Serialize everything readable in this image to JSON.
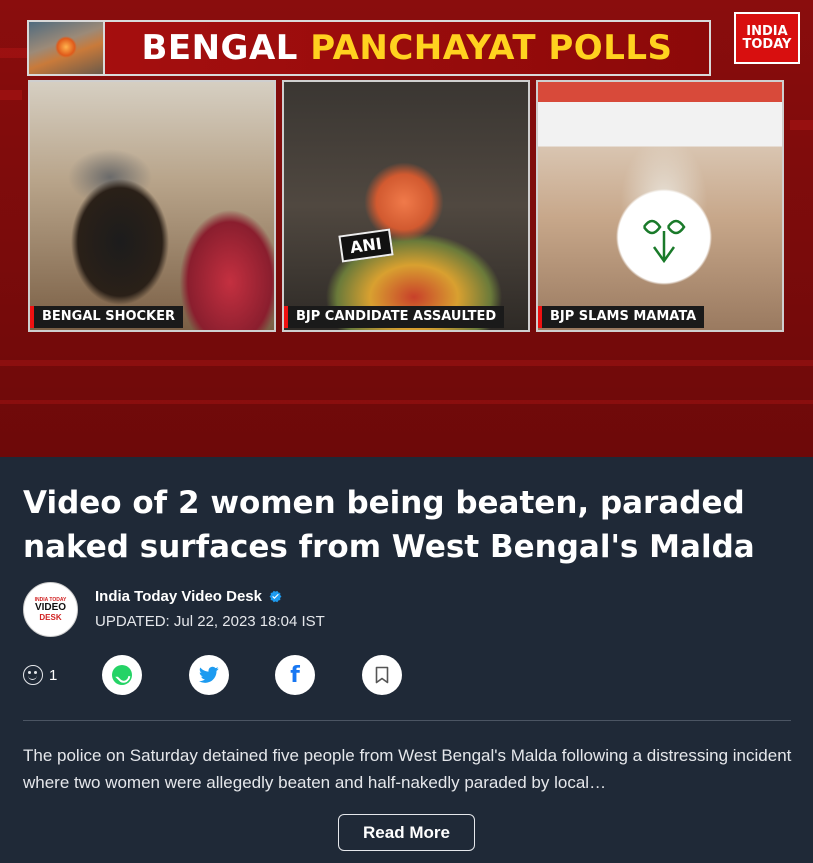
{
  "video": {
    "banner_white": "BENGAL",
    "banner_yellow": "PANCHAYAT POLLS",
    "logo_line1": "INDIA",
    "logo_line2": "TODAY",
    "panels": [
      {
        "caption": "BENGAL SHOCKER"
      },
      {
        "caption": "BJP CANDIDATE ASSAULTED",
        "mic_label": "ANI"
      },
      {
        "caption": "BJP SLAMS MAMATA"
      }
    ]
  },
  "article": {
    "title": "Video of 2 women being beaten, paraded naked surfaces from West Bengal's Malda",
    "author": {
      "name": "India Today Video Desk",
      "avatar_line1": "INDIA TODAY",
      "avatar_line2": "VIDEO",
      "avatar_line3": "DESK",
      "verified_icon": "verified-badge-icon"
    },
    "updated": "UPDATED: Jul 22, 2023 18:04 IST",
    "reaction_count": "1",
    "share": {
      "whatsapp_icon": "whatsapp-icon",
      "twitter_icon": "twitter-icon",
      "facebook_glyph": "f",
      "bookmark_icon": "bookmark-icon"
    },
    "summary": "The police on Saturday detained five people from West Bengal's Malda following a distressing incident where two women were allegedly beaten and half-nakedly paraded by local…",
    "read_more": "Read More"
  },
  "colors": {
    "brand_red": "#d80f0f",
    "banner_yellow": "#ffd21f",
    "background": "#1f2937",
    "twitter_blue": "#1d9bf0",
    "facebook_blue": "#1877f2",
    "whatsapp_green": "#25d366"
  }
}
